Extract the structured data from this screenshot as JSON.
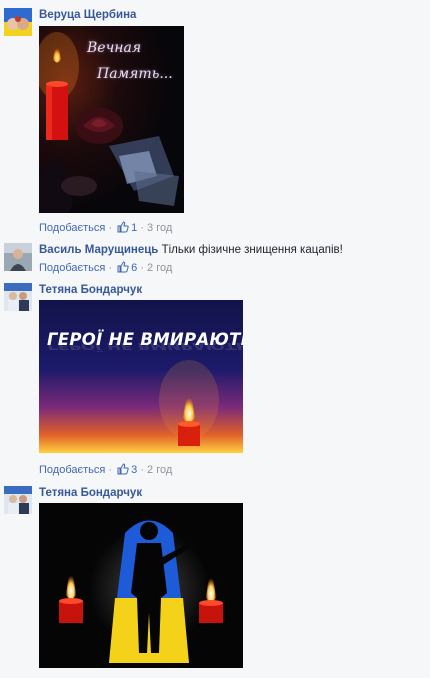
{
  "comments": [
    {
      "author": "Веруца Щербина",
      "text": "",
      "image_caption": [
        "Вечная",
        "Память..."
      ],
      "like_label": "Подобається",
      "like_count": "1",
      "time": "3 год"
    },
    {
      "author": "Василь Марущинець",
      "text": "Тільки фізичне знищення кацапів!",
      "like_label": "Подобається",
      "like_count": "6",
      "time": "2 год"
    },
    {
      "author": "Тетяна Бондарчук",
      "text": "",
      "image_caption": "ГЕРОЇ НЕ ВМИРАЮТЬ",
      "like_label": "Подобається",
      "like_count": "3",
      "time": "2 год"
    },
    {
      "author": "Тетяна Бондарчук",
      "text": ""
    }
  ],
  "separator": "·",
  "colors": {
    "link": "#365899",
    "like": "#4267b2",
    "meta": "#90949c",
    "background": "#f6f7f9"
  },
  "icons": [
    "thumbs-up-icon",
    "candle-icon",
    "rose-icon",
    "soldier-silhouette-icon"
  ]
}
